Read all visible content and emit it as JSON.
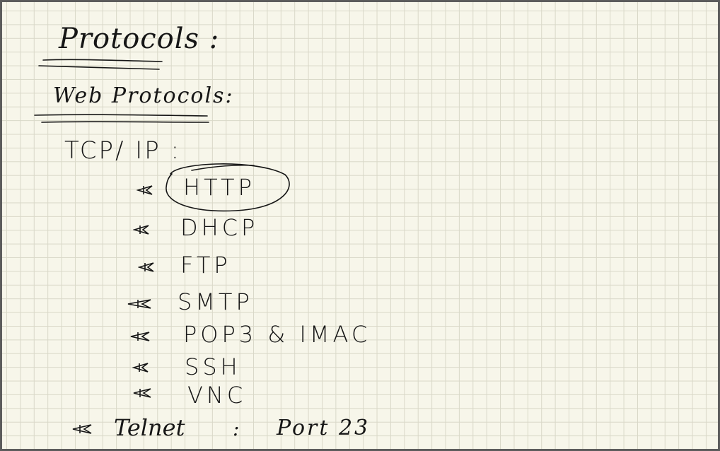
{
  "notes": {
    "title": "Protocols :",
    "subtitle": "Web Protocols:",
    "section": "TCP/ IP :",
    "items": [
      {
        "label": "HTTP",
        "circled": true
      },
      {
        "label": "DHCP"
      },
      {
        "label": "FTP"
      },
      {
        "label": "SMTP"
      },
      {
        "label": "POP3 & IMAC"
      },
      {
        "label": "SSH"
      },
      {
        "label": "VNC"
      }
    ],
    "telnet": {
      "label": "Telnet",
      "separator": ":",
      "port": "Port 23"
    }
  },
  "icons": {
    "bullet": "star-bullet-icon"
  },
  "colors": {
    "ink": "#161616",
    "paper": "#f7f6ea",
    "grid": "#d9d8c8"
  }
}
